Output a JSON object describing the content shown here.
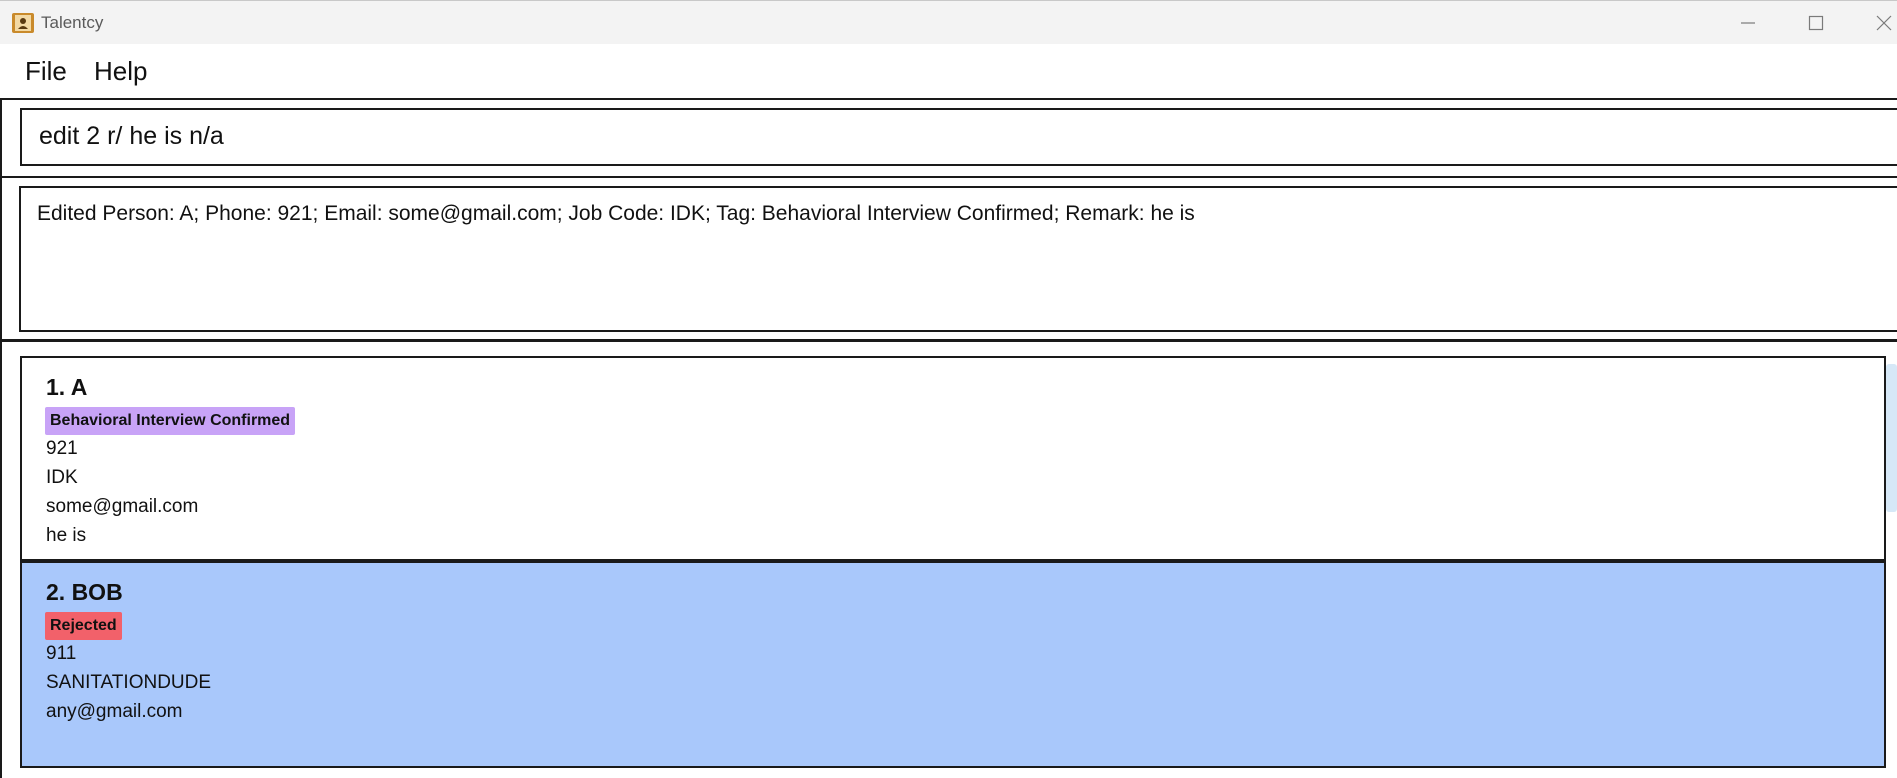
{
  "window": {
    "title": "Talentcy",
    "icon": "contacts-book-icon"
  },
  "menu": {
    "items": [
      {
        "label": "File"
      },
      {
        "label": "Help"
      }
    ]
  },
  "command": {
    "value": "edit 2 r/ he is n/a"
  },
  "result": {
    "text": "Edited Person: A; Phone: 921; Email: some@gmail.com; Job Code: IDK; Tag: Behavioral Interview Confirmed; Remark: he is"
  },
  "persons": [
    {
      "title": "1. A",
      "tag": "Behavioral Interview Confirmed",
      "tag_color": "#c8a3f7",
      "phone": "921",
      "job_code": "IDK",
      "email": "some@gmail.com",
      "remark": "he is",
      "selected": false
    },
    {
      "title": "2. BOB",
      "tag": "Rejected",
      "tag_color": "#f2616a",
      "phone": "911",
      "job_code": "SANITATIONDUDE",
      "email": "any@gmail.com",
      "remark": "",
      "selected": true
    }
  ],
  "colors": {
    "selected_card": "#a9c8fb",
    "titlebar": "#f3f3f3"
  }
}
